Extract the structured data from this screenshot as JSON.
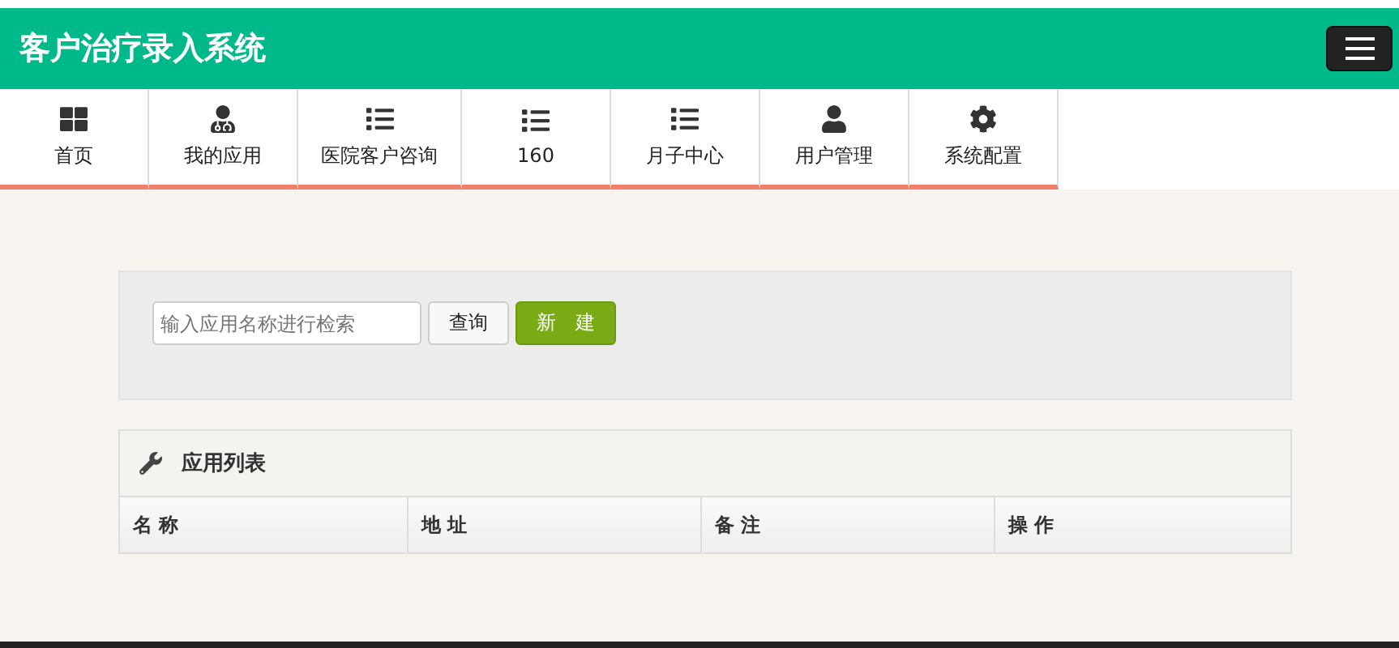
{
  "header": {
    "title": "客户治疗录入系统"
  },
  "nav": [
    {
      "label": "首页",
      "kind": "grid"
    },
    {
      "label": "我的应用",
      "kind": "doctor"
    },
    {
      "label": "医院客户咨询",
      "kind": "list"
    },
    {
      "label": "160",
      "kind": "list"
    },
    {
      "label": "月子中心",
      "kind": "list"
    },
    {
      "label": "用户管理",
      "kind": "user"
    },
    {
      "label": "系统配置",
      "kind": "gear"
    }
  ],
  "search": {
    "placeholder": "输入应用名称进行检索",
    "query_button": "查询",
    "new_button": "新　建"
  },
  "panel": {
    "title": "应用列表",
    "columns": [
      "名 称",
      "地 址",
      "备 注",
      "操 作"
    ]
  }
}
